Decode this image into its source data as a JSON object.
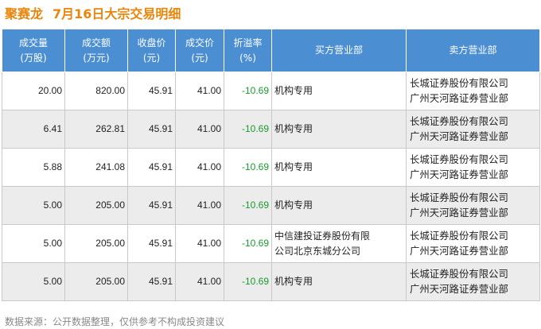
{
  "header": {
    "stock_name": "聚赛龙",
    "subtitle": "7月16日大宗交易明细"
  },
  "table": {
    "columns": [
      [
        "成交量",
        "(万股)"
      ],
      [
        "成交额",
        "(万元)"
      ],
      [
        "收盘价",
        "(元)"
      ],
      [
        "成交价",
        "(元)"
      ],
      [
        "折溢率",
        "(%)"
      ],
      [
        "买方营业部"
      ],
      [
        "卖方营业部"
      ]
    ],
    "rows": [
      {
        "volume": "20.00",
        "amount": "820.00",
        "close": "45.91",
        "price": "41.00",
        "premium": "-10.69",
        "buyer": [
          "机构专用"
        ],
        "seller": [
          "长城证券股份有限公司",
          "广州天河路证券营业部"
        ]
      },
      {
        "volume": "6.41",
        "amount": "262.81",
        "close": "45.91",
        "price": "41.00",
        "premium": "-10.69",
        "buyer": [
          "机构专用"
        ],
        "seller": [
          "长城证券股份有限公司",
          "广州天河路证券营业部"
        ]
      },
      {
        "volume": "5.88",
        "amount": "241.08",
        "close": "45.91",
        "price": "41.00",
        "premium": "-10.69",
        "buyer": [
          "机构专用"
        ],
        "seller": [
          "长城证券股份有限公司",
          "广州天河路证券营业部"
        ]
      },
      {
        "volume": "5.00",
        "amount": "205.00",
        "close": "45.91",
        "price": "41.00",
        "premium": "-10.69",
        "buyer": [
          "机构专用"
        ],
        "seller": [
          "长城证券股份有限公司",
          "广州天河路证券营业部"
        ]
      },
      {
        "volume": "5.00",
        "amount": "205.00",
        "close": "45.91",
        "price": "41.00",
        "premium": "-10.69",
        "buyer": [
          "中信建投证券股份有限",
          "公司北京东城分公司"
        ],
        "seller": [
          "长城证券股份有限公司",
          "广州天河路证券营业部"
        ]
      },
      {
        "volume": "5.00",
        "amount": "205.00",
        "close": "45.91",
        "price": "41.00",
        "premium": "-10.69",
        "buyer": [
          "机构专用"
        ],
        "seller": [
          "长城证券股份有限公司",
          "广州天河路证券营业部"
        ]
      }
    ]
  },
  "footer": {
    "source": "数据来源：公开数据整理，仅供参考不构成投资建议"
  },
  "colors": {
    "title": "#e8860c",
    "header_bg": "#4b8ed1",
    "negative": "#1a9c2a",
    "stripe": "#ececec"
  }
}
